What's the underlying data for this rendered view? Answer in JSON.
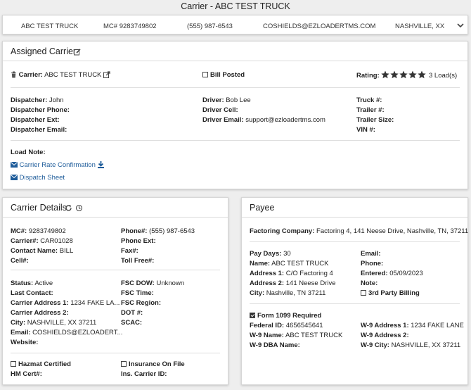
{
  "page_title": "Carrier - ABC TEST TRUCK",
  "summary": {
    "carrier": "ABC TEST TRUCK",
    "mc": "MC# 9283749802",
    "phone": "(555) 987-6543",
    "email": "COSHIELDS@EZLOADERTMS.COM",
    "location": "NASHVILLE, XX"
  },
  "assigned": {
    "title": "Assigned Carrier",
    "carrier_label": "Carrier:",
    "carrier_value": "ABC TEST TRUCK",
    "bill_posted": "Bill Posted",
    "rating_label": "Rating:",
    "rating_value": 5,
    "loads": "3 Load(s)",
    "dispatcher_label": "Dispatcher:",
    "dispatcher_value": "John",
    "dispatcher_phone": "Dispatcher Phone:",
    "dispatcher_ext": "Dispatcher Ext:",
    "dispatcher_email": "Dispatcher Email:",
    "driver_label": "Driver:",
    "driver_value": "Bob Lee",
    "driver_cell": "Driver Cell:",
    "driver_email_label": "Driver Email:",
    "driver_email_value": "support@ezloadertms.com",
    "truck": "Truck #:",
    "trailer": "Trailer #:",
    "trailer_size": "Trailer Size:",
    "vin": "VIN #:",
    "load_note": "Load Note:",
    "rate_conf": "Carrier Rate Confirmation",
    "dispatch_sheet": "Dispatch Sheet"
  },
  "details": {
    "title": "Carrier Details",
    "mc_label": "MC#:",
    "mc_value": "9283749802",
    "carrier_no_label": "Carrier#:",
    "carrier_no_value": "CAR01028",
    "contact_label": "Contact Name:",
    "contact_value": "BILL",
    "cell_label": "Cell#:",
    "phone_label": "Phone#:",
    "phone_value": "(555) 987-6543",
    "phone_ext": "Phone Ext:",
    "fax": "Fax#:",
    "toll_free": "Toll Free#:",
    "status_label": "Status:",
    "status_value": "Active",
    "last_contact": "Last Contact:",
    "addr1_label": "Carrier Address 1:",
    "addr1_value": "1234 FAKE LA...",
    "addr2_label": "Carrier Address 2:",
    "city_label": "City:",
    "city_value": "NASHVILLE, XX 37211",
    "email_label": "Email:",
    "email_value": "COSHIELDS@EZLOADERT...",
    "website": "Website:",
    "fsc_dow_label": "FSC DOW:",
    "fsc_dow_value": "Unknown",
    "fsc_time": "FSC Time:",
    "fsc_region": "FSC Region:",
    "dot": "DOT #:",
    "scac": "SCAC:",
    "hazmat": "Hazmat Certified",
    "insurance": "Insurance On File",
    "hm_cert": "HM Cert#:",
    "ins_carrier": "Ins. Carrier ID:"
  },
  "payee": {
    "title": "Payee",
    "factoring_label": "Factoring Company:",
    "factoring_value": "Factoring 4, 141 Neese Drive, Nashville, TN, 37211",
    "pay_days_label": "Pay Days:",
    "pay_days_value": "30",
    "name_label": "Name:",
    "name_value": "ABC TEST TRUCK",
    "addr1_label": "Address 1:",
    "addr1_value": "C/O Factoring 4",
    "addr2_label": "Address 2:",
    "addr2_value": "141 Neese Drive",
    "city_label": "City:",
    "city_value": "Nashville, TN 37211",
    "email": "Email:",
    "phone": "Phone:",
    "entered_label": "Entered:",
    "entered_value": "05/09/2023",
    "note": "Note:",
    "third_party": "3rd Party Billing",
    "form1099": "Form 1099 Required",
    "federal_label": "Federal ID:",
    "federal_value": "4656545641",
    "w9name_label": "W-9 Name:",
    "w9name_value": "ABC TEST TRUCK",
    "w9dba_label": "W-9 DBA Name:",
    "w9addr1_label": "W-9 Address 1:",
    "w9addr1_value": "1234 FAKE LANE",
    "w9addr2_label": "W-9 Address 2:",
    "w9city_label": "W-9 City:",
    "w9city_value": "NASHVILLE, XX 37211"
  },
  "colors": {
    "link": "#1e5c9a",
    "star": "#333333",
    "border": "#d6d6d6"
  }
}
